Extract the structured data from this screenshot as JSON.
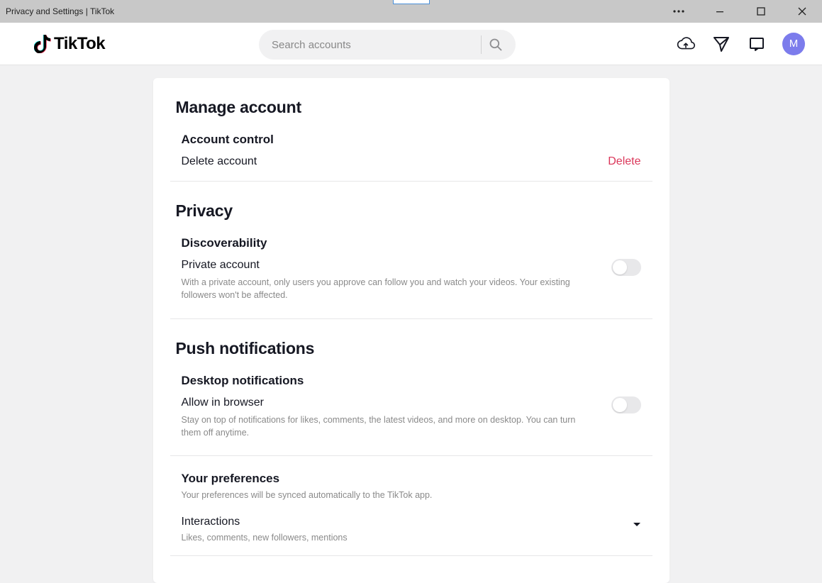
{
  "window": {
    "title": "Privacy and Settings | TikTok"
  },
  "header": {
    "brand": "TikTok",
    "search_placeholder": "Search accounts",
    "avatar_initial": "M"
  },
  "settings": {
    "manage_account": {
      "title": "Manage account",
      "account_control_heading": "Account control",
      "delete_label": "Delete account",
      "delete_action": "Delete"
    },
    "privacy": {
      "title": "Privacy",
      "discoverability_heading": "Discoverability",
      "private_account_label": "Private account",
      "private_account_desc": "With a private account, only users you approve can follow you and watch your videos. Your existing followers won't be affected.",
      "private_account_on": false
    },
    "push": {
      "title": "Push notifications",
      "desktop_heading": "Desktop notifications",
      "allow_label": "Allow in browser",
      "allow_desc": "Stay on top of notifications for likes, comments, the latest videos, and more on desktop. You can turn them off anytime.",
      "allow_on": false,
      "prefs_heading": "Your preferences",
      "prefs_desc": "Your preferences will be synced automatically to the TikTok app.",
      "interactions_label": "Interactions",
      "interactions_desc": "Likes, comments, new followers, mentions"
    }
  }
}
